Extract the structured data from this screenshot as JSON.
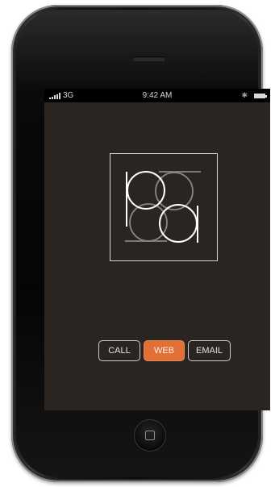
{
  "status_bar": {
    "carrier": "3G",
    "time": "9:42 AM",
    "bluetooth": "✱"
  },
  "app": {
    "logo": {
      "icon": "pa-monogram-logo",
      "colors": {
        "primary_stroke": "#ffffff",
        "secondary_stroke": "#8a8584"
      }
    },
    "buttons": [
      {
        "label": "CALL"
      },
      {
        "label": "WEB"
      },
      {
        "label": "EMAIL"
      }
    ],
    "colors": {
      "accent": "#e26f36",
      "background": "#2b2522"
    }
  }
}
